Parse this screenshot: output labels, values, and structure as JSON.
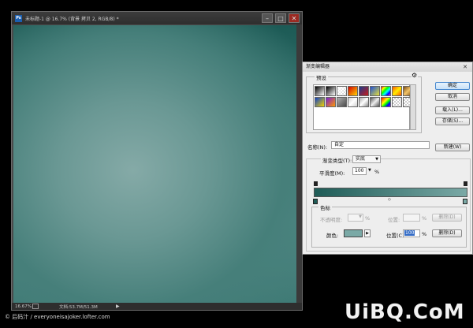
{
  "document": {
    "title": "未标题-1 @ 16.7% (背景 拷贝 2, RGB/8) *",
    "app_icon": "Ps",
    "minimize": "–",
    "maximize": "□",
    "close": "✕",
    "zoom": "16.67%",
    "doc_info": "文档:53.7M/51.3M",
    "status_arrow": "▶"
  },
  "dialog": {
    "title": "渐变编辑器",
    "close": "✕",
    "presets_label": "预设",
    "gear_icon": "⚙",
    "swatches": [
      "linear-gradient(135deg,#000,#fff)",
      "linear-gradient(135deg,#000,rgba(0,0,0,0))",
      "linear-gradient(135deg,#fff,rgba(255,255,255,0)),repeating-conic-gradient(#ccc 0 25%,#fff 0 50%) 0 0/4px 4px",
      "linear-gradient(135deg,#d40000,#ffd400)",
      "linear-gradient(135deg,#1b3a8a,#c81b1b)",
      "linear-gradient(135deg,#1e4fd8,#e5e03a)",
      "linear-gradient(135deg,#ff0000,#ffff00,#00ff00,#00ffff,#0000ff,#ff00ff)",
      "linear-gradient(135deg,#ff5500,#ffee00,#ff5500)",
      "linear-gradient(135deg,#7a4a14,#f2c46a,#7a4a14)",
      "linear-gradient(135deg,#0d3fc7,#f5d400)",
      "linear-gradient(135deg,#7a1ed1,#ff9800)",
      "linear-gradient(135deg,#b0b0b0,#4a4a4a)",
      "linear-gradient(135deg,#d0d0d0,#ffffff,#d0d0d0)",
      "linear-gradient(135deg,#aaa,#fff,#888)",
      "linear-gradient(135deg,#555,#eee,#555)",
      "linear-gradient(135deg,#ff0000,#ff8800,#ffff00,#00ff00,#0000ff,#8800ff)",
      "repeating-conic-gradient(#ccc 0 25%,#fff 0 50%) 0 0/4px 4px",
      "repeating-conic-gradient(#ccc 0 25%,#fff 0 50%) 0 0/4px 4px"
    ],
    "ok_label": "确定",
    "cancel_label": "取消",
    "load_label": "载入(L)...",
    "save_label": "存储(S)...",
    "name_label": "名称(N):",
    "name_value": "自定",
    "new_label": "新建(W)",
    "gradient_type_label": "渐变类型(T):",
    "gradient_type_value": "实底",
    "dropdown_arrow": "▼",
    "smoothness_label": "平滑度(M):",
    "smoothness_value": "100",
    "percent": "%",
    "midpoint_icon": "◇",
    "stops_label": "色标",
    "opacity_label": "不透明度:",
    "location_label": "位置:",
    "delete_label": "删除(D)",
    "color_label": "颜色:",
    "color_arrow": "▶",
    "location_label_active": "位置(C):",
    "location_value": "100",
    "gradient_start": "#1f5c57",
    "gradient_end": "#7aa9a6"
  },
  "watermarks": {
    "left": "© 后码汁 / everyoneisajoker.lofter.com",
    "right": "UiBQ.CoM"
  }
}
